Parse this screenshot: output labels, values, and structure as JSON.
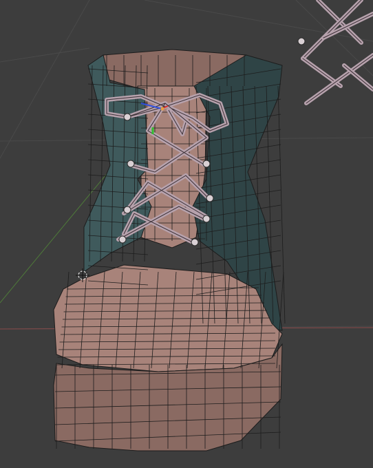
{
  "viewport": {
    "background": "#3d3d3d",
    "grid_color": "#4a4a4a",
    "axis_x_color": "#8a4a4a",
    "axis_y_color": "#4e7a3a",
    "wire_color": "#1c1c1c"
  },
  "object": {
    "leather_color": "#a8837a",
    "leather_shadow": "#8a6a62",
    "collar_color": "#3f5a5c",
    "collar_shadow": "#2f4446",
    "lace_color": "#b7a2ad",
    "eyelet_color": "#d9d0d4"
  },
  "gizmo": {
    "x_color": "#e03030",
    "y_color": "#30c030",
    "z_color": "#3050e0"
  }
}
